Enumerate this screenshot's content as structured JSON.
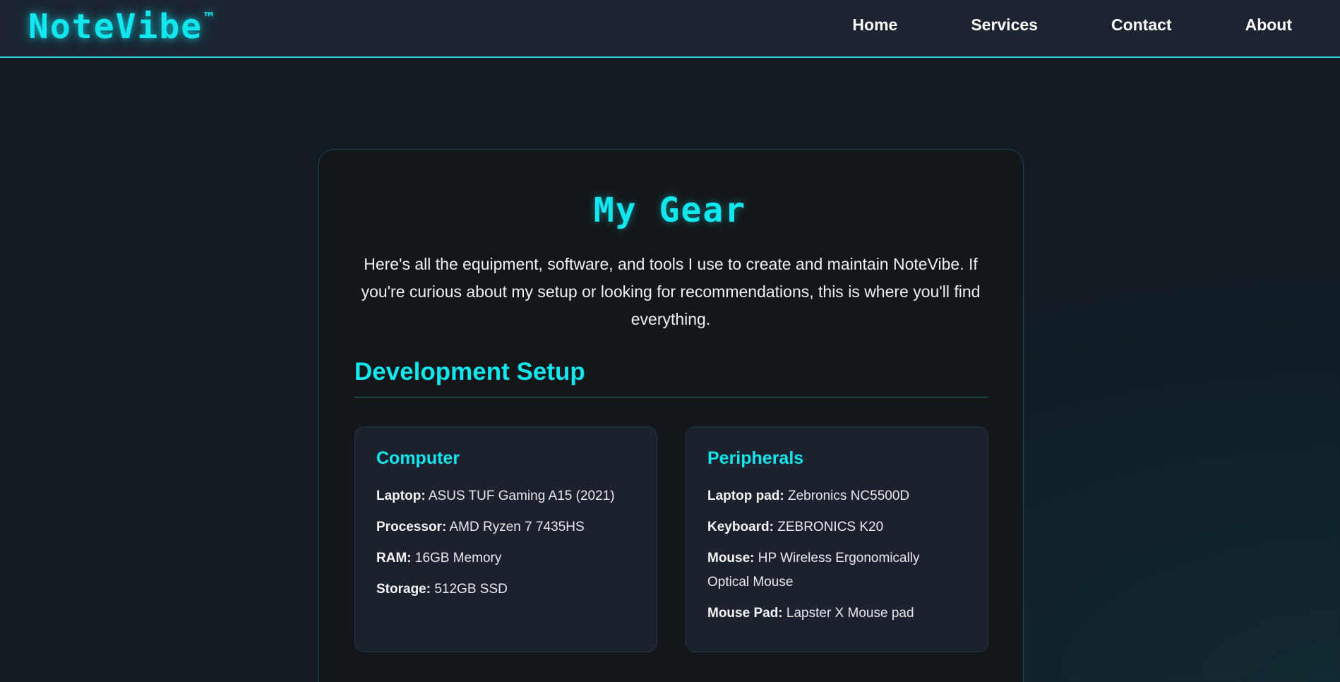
{
  "nav": {
    "logo": "NoteVibe",
    "logo_mark": "™",
    "links": [
      "Home",
      "Services",
      "Contact",
      "About"
    ]
  },
  "main": {
    "title": "My Gear",
    "intro": "Here's all the equipment, software, and tools I use to create and maintain NoteVibe. If you're curious about my setup or looking for recommendations, this is where you'll find everything.",
    "section_title": "Development Setup",
    "cards": [
      {
        "title": "Computer",
        "items": [
          {
            "key": "Laptop:",
            "value": " ASUS TUF Gaming A15 (2021)"
          },
          {
            "key": "Processor:",
            "value": " AMD Ryzen 7 7435HS"
          },
          {
            "key": "RAM:",
            "value": " 16GB Memory"
          },
          {
            "key": "Storage:",
            "value": " 512GB SSD"
          }
        ]
      },
      {
        "title": "Peripherals",
        "items": [
          {
            "key": "Laptop pad:",
            "value": " Zebronics NC5500D"
          },
          {
            "key": "Keyboard:",
            "value": " ZEBRONICS K20"
          },
          {
            "key": "Mouse:",
            "value": " HP Wireless Ergonomically Optical Mouse"
          },
          {
            "key": "Mouse Pad:",
            "value": " Lapster X Mouse pad"
          }
        ]
      }
    ]
  },
  "colors": {
    "accent": "#12e7f0",
    "nav_bg": "#1c2431",
    "card_bg": "#141719",
    "gear_card_bg": "#1c222d"
  }
}
